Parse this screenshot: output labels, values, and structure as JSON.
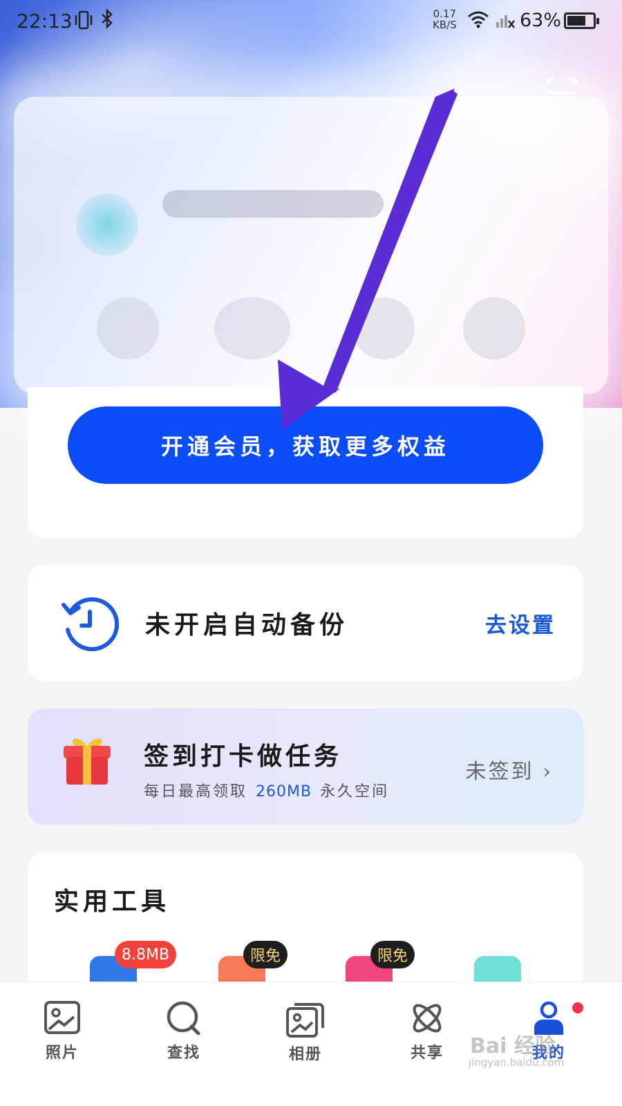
{
  "status_bar": {
    "time": "22:13",
    "net_speed_value": "0.17",
    "net_speed_unit": "KB/S",
    "battery": "63%"
  },
  "vip": {
    "button_label": "开通会员，获取更多权益"
  },
  "backup": {
    "text": "未开启自动备份",
    "action": "去设置"
  },
  "sign_in": {
    "title": "签到打卡做任务",
    "sub_prefix": "每日最高领取",
    "sub_amount": "260MB",
    "sub_suffix": "永久空间",
    "status": "未签到"
  },
  "tools": {
    "title": "实用工具",
    "badges": [
      "8.8MB",
      "限免",
      "限免"
    ]
  },
  "bottom_nav": {
    "items": [
      {
        "label": "照片",
        "icon": "photo-icon"
      },
      {
        "label": "查找",
        "icon": "search-icon"
      },
      {
        "label": "相册",
        "icon": "album-icon"
      },
      {
        "label": "共享",
        "icon": "share-icon"
      },
      {
        "label": "我的",
        "icon": "profile-icon",
        "active": true
      }
    ]
  },
  "watermark": {
    "text": "Bai 经验",
    "url": "jingyan.baidu.com"
  },
  "colors": {
    "primary": "#0a4cf5",
    "link": "#1859d9",
    "arrow": "#5b2bd6",
    "badge_red": "#f0423a",
    "badge_dark": "#1e1e1e"
  }
}
